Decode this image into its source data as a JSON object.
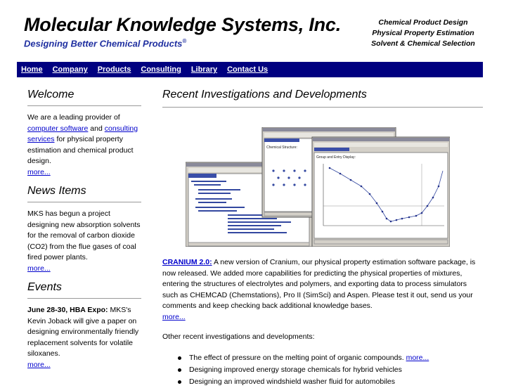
{
  "header": {
    "title": "Molecular Knowledge Systems, Inc.",
    "tagline": "Designing Better Chemical Products",
    "tagline_mark": "®",
    "services": [
      "Chemical Product Design",
      "Physical Property Estimation",
      "Solvent & Chemical Selection"
    ]
  },
  "nav": {
    "items": [
      "Home",
      "Company",
      "Products",
      "Consulting",
      "Library",
      "Contact Us"
    ],
    "color": "#000080"
  },
  "sidebar": {
    "welcome": {
      "heading": "Welcome",
      "text_a": "We are a leading provider of",
      "link_software": "computer software",
      "text_b": "and",
      "link_consulting": "consulting services",
      "text_c": "for physical property estimation and chemical product design.",
      "more": "more..."
    },
    "news": {
      "heading": "News Items",
      "text": "MKS has begun a project designing new absorption solvents for the removal of carbon dioxide (CO2) from the flue gases of coal fired power plants.",
      "more": "more..."
    },
    "events": {
      "heading": "Events",
      "bold": "June 28-30, HBA Expo:",
      "text": "MKS's Kevin Joback will give a paper on designing environmentally friendly replacement solvents for volatile siloxanes.",
      "more": "more..."
    }
  },
  "main": {
    "heading": "Recent Investigations and Developments",
    "screenshot": {
      "win1_title": "Chemical Structure:",
      "win2_title": "Group and Entry Display:"
    },
    "cranium": {
      "link": "CRANIUM 2.0:",
      "text": "A new version of Cranium, our physical property estimation software package, is now released. We added more capabilities for predicting the physical properties of mixtures, entering the structures of electrolytes and polymers, and exporting data to process simulators such as CHEMCAD (Chemstations), Pro II (SimSci) and Aspen. Please test it out, send us your comments and keep checking back additional knowledge bases.",
      "more": "more..."
    },
    "other_intro": "Other recent investigations and developments:",
    "bullets": [
      {
        "text": "The effect of pressure on the melting point of organic compounds.",
        "more": "more..."
      },
      {
        "text": "Designing improved energy storage chemicals for hybrid vehicles",
        "more": ""
      },
      {
        "text": "Designing an improved windshield washer fluid for automobiles",
        "more": ""
      }
    ]
  }
}
